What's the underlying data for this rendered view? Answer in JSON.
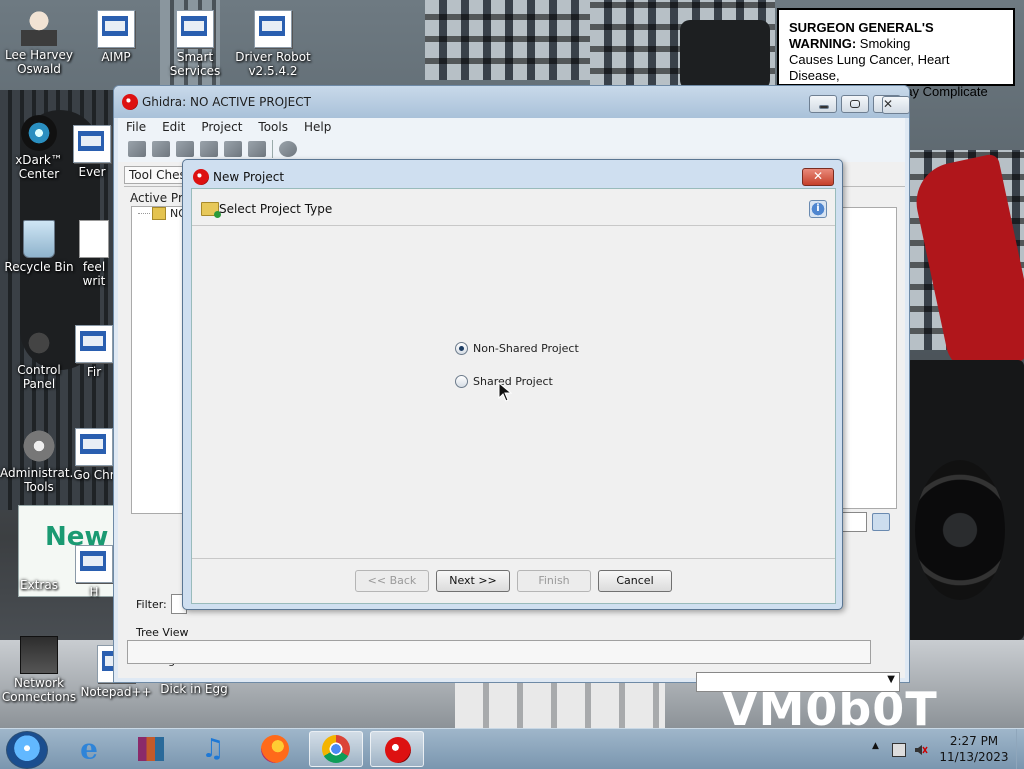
{
  "desktop": {
    "warning": {
      "heading": "SURGEON GENERAL'S WARNING:",
      "line1": "Smoking",
      "line2": "Causes Lung Cancer, Heart Disease,",
      "line3": "Emphysema, And May Complicate Pregnancy."
    },
    "watermark": "VM0b0T",
    "icons": [
      {
        "label": "Lee Harvey Oswald",
        "icon": "person-icon"
      },
      {
        "label": "AIMP",
        "icon": "app-icon"
      },
      {
        "label": "Smart Services",
        "icon": "app-icon"
      },
      {
        "label": "Driver Robot v2.5.4.2",
        "icon": "app-shield-icon"
      },
      {
        "label": "xDark™ Center",
        "icon": "camera-icon"
      },
      {
        "label": "Ever",
        "icon": "app-icon"
      },
      {
        "label": "Recycle Bin",
        "icon": "recycle-bin-icon"
      },
      {
        "label": "feel writ",
        "icon": "document-icon"
      },
      {
        "label": "Control Panel",
        "icon": "control-panel-icon"
      },
      {
        "label": "Fir",
        "icon": "app-icon"
      },
      {
        "label": "Administrat... Tools",
        "icon": "gears-icon"
      },
      {
        "label": "Go Chr",
        "icon": "app-icon"
      },
      {
        "label": "Extras",
        "icon": "folder-icon"
      },
      {
        "label": "H",
        "icon": "app-icon"
      },
      {
        "label": "Network Connections",
        "icon": "network-icon"
      },
      {
        "label": "Notepad++",
        "icon": "app-icon"
      },
      {
        "label": "Dick in Egg",
        "icon": "app-icon"
      }
    ]
  },
  "ghidra": {
    "title": "Ghidra: NO ACTIVE PROJECT",
    "menu": [
      "File",
      "Edit",
      "Project",
      "Tools",
      "Help"
    ],
    "tool_chest_label": "Tool Chest",
    "active_project_label": "Active Proj",
    "tree_node": "NO",
    "filter_label": "Filter:",
    "tree_view_tab": "Tree View",
    "running_tools_label": "Running To"
  },
  "dialog": {
    "title": "New Project",
    "close_label": "✕",
    "header_text": "Select Project Type",
    "options": [
      {
        "label": "Non-Shared Project",
        "selected": true
      },
      {
        "label": "Shared Project",
        "selected": false
      }
    ],
    "buttons": {
      "back": "<< Back",
      "next": "Next >>",
      "finish": "Finish",
      "cancel": "Cancel"
    }
  },
  "taskbar": {
    "time": "2:27 PM",
    "date": "11/13/2023",
    "apps": [
      "start",
      "internet-explorer",
      "winrar",
      "media-player",
      "firefox",
      "chrome",
      "ghidra"
    ],
    "active_app": "ghidra"
  }
}
